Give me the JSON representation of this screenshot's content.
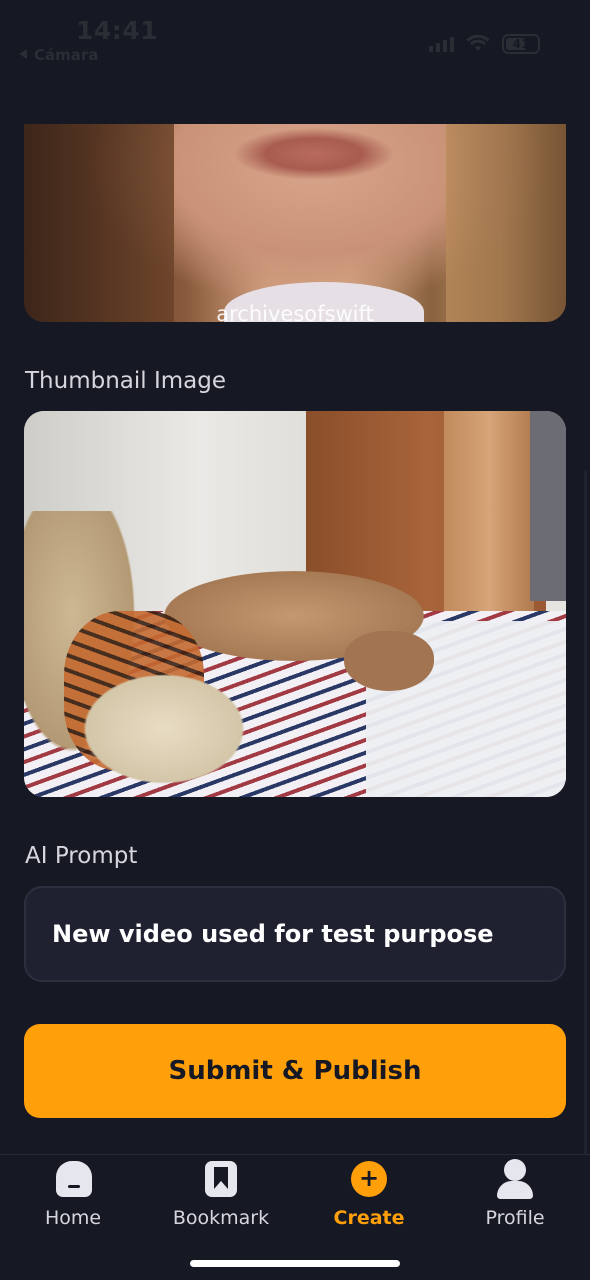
{
  "status_bar": {
    "time": "14:41",
    "back_app": "Cámara",
    "battery": "41"
  },
  "video": {
    "watermark": "archivesofswift"
  },
  "thumbnail": {
    "label": "Thumbnail Image"
  },
  "ai_prompt": {
    "label": "AI Prompt",
    "value": "New video used for test purpose"
  },
  "submit": {
    "label": "Submit & Publish"
  },
  "tabbar": {
    "items": [
      {
        "label": "Home",
        "icon": "home-icon",
        "active": false
      },
      {
        "label": "Bookmark",
        "icon": "bookmark-icon",
        "active": false
      },
      {
        "label": "Create",
        "icon": "plus-circle-icon",
        "active": true
      },
      {
        "label": "Profile",
        "icon": "person-icon",
        "active": false
      }
    ]
  },
  "colors": {
    "background": "#161824",
    "accent": "#ff9f0a",
    "field": "#1f2130"
  }
}
